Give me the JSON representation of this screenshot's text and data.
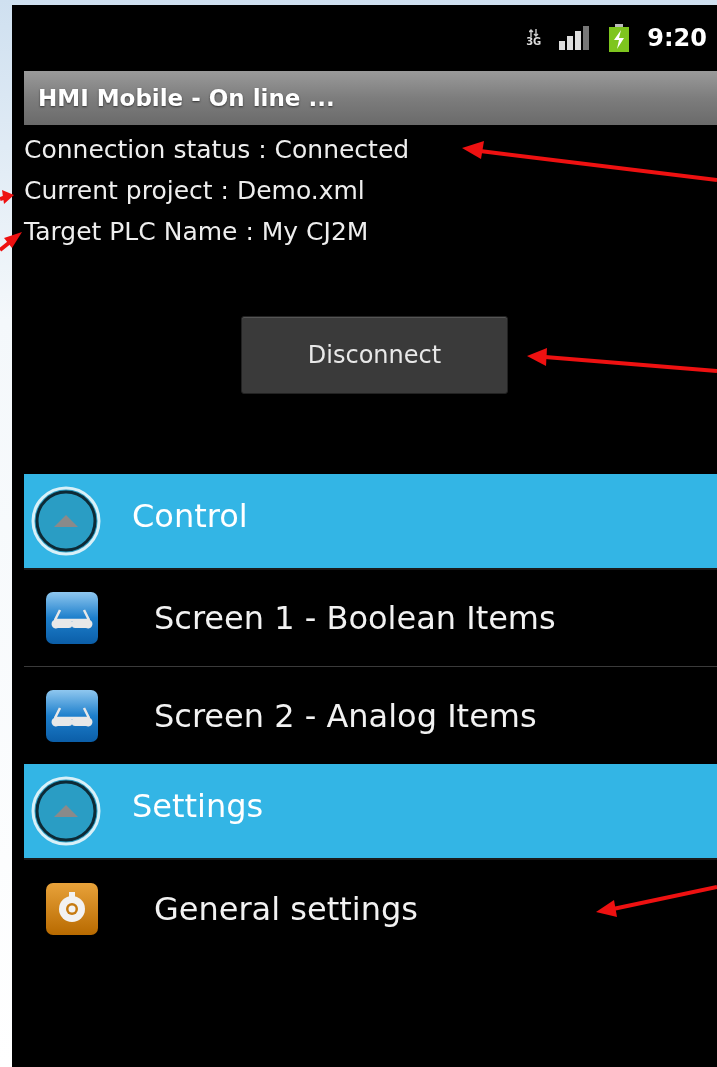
{
  "status_bar": {
    "network": "3G",
    "time": "9:20"
  },
  "title_bar": {
    "title": "HMI Mobile - On line ..."
  },
  "info_lines": [
    "Connection status : Connected",
    "Current project : Demo.xml",
    "Target PLC Name : My CJ2M"
  ],
  "disconnect_button": {
    "label": "Disconnect"
  },
  "groups": [
    {
      "title": "Control",
      "expanded": true,
      "items": [
        {
          "label": "Screen 1 - Boolean Items",
          "kind": "screen"
        },
        {
          "label": "Screen 2 - Analog Items",
          "kind": "screen"
        }
      ]
    },
    {
      "title": "Settings",
      "expanded": true,
      "items": [
        {
          "label": "General settings",
          "kind": "settings"
        }
      ]
    }
  ]
}
